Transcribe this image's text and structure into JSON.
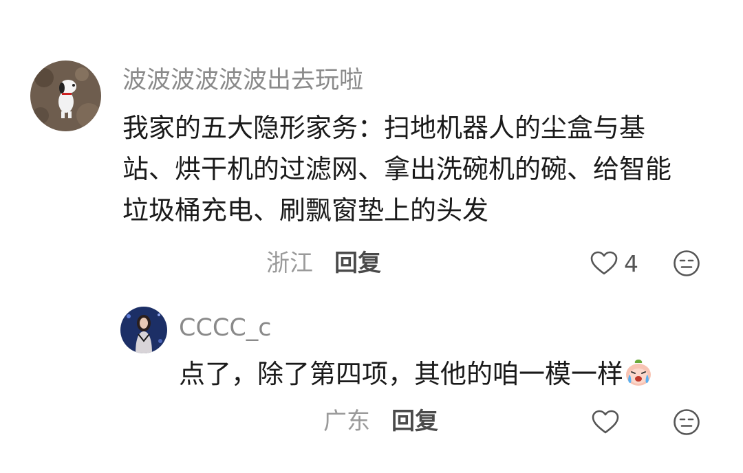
{
  "comment": {
    "username": "波波波波波波出去玩啦",
    "lines": [
      "我家的五大隐形家务：扫地机器人的尘盒与基",
      "站、烘干机的过滤网、拿出洗碗机的碗、给智能",
      "垃圾桶充电、刷飘窗垫上的头发"
    ],
    "location": "浙江",
    "reply_label": "回复",
    "like_count": "4"
  },
  "reply": {
    "username": "CCCC_c",
    "text": "点了，除了第四项，其他的咱一模一样",
    "location": "广东",
    "reply_label": "回复"
  },
  "icons": {
    "like": "heart-outline-icon",
    "react": "neutral-face-icon",
    "emoji": "crying-peach-emoji"
  },
  "colors": {
    "username": "#8a8a8a",
    "text": "#1a1a1a",
    "location": "#9a9a9a",
    "reply": "#4a4a4a"
  }
}
